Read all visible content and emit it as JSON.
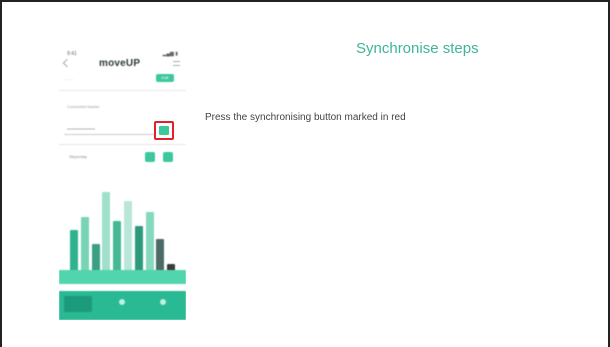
{
  "slide": {
    "title": "Synchronise steps",
    "instruction": "Press the synchronising button marked in red",
    "title_color": "#3fb59a",
    "highlight_color": "#e0212a"
  },
  "phone": {
    "status_time": "9:41",
    "status_icons": "▂▄▆ ▮",
    "brand": "moveUP",
    "menu_hint": "........",
    "pill_label": "Edit",
    "field_label": "Connected tracker",
    "field_value": "••••••••••••••••••••",
    "toggle_label": "Steps/day",
    "tab_caption": "",
    "accent": "#3cc79c",
    "icons": [
      "back-icon",
      "menu-icon",
      "sync-icon",
      "chart-icon",
      "home-icon",
      "profile-icon"
    ]
  },
  "chart_data": {
    "type": "bar",
    "categories": [
      "",
      "",
      "",
      "",
      "",
      "",
      "",
      "",
      "",
      ""
    ],
    "series": [
      {
        "values": [
          58,
          72,
          42,
          100,
          68,
          90,
          62,
          78,
          48,
          20
        ]
      }
    ],
    "ylim": [
      0,
      100
    ],
    "colors": [
      "#2fb38e",
      "#79d3b5",
      "#3a9f84",
      "#9fe0cb",
      "#46b994",
      "#b8e7da",
      "#2e9a7d",
      "#86d8bf",
      "#4d6b66",
      "#3a3a3a"
    ]
  }
}
